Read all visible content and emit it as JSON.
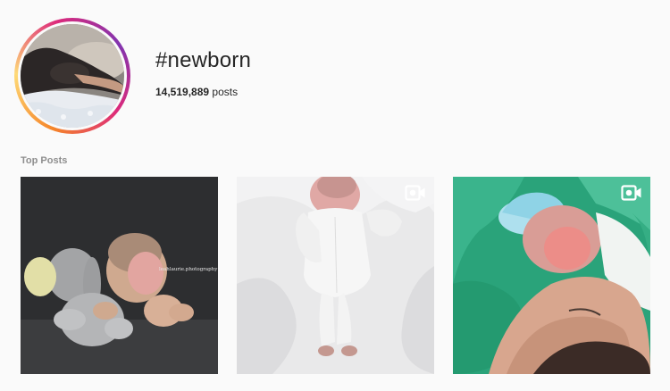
{
  "hashtag": {
    "title": "#newborn",
    "post_count": "14,519,889",
    "post_count_suffix": " posts"
  },
  "section": {
    "title": "Top Posts"
  },
  "posts": [
    {
      "watermark": "leahlaurie.photography",
      "media": "photo",
      "icon": ""
    },
    {
      "watermark": "",
      "media": "video",
      "icon": "video-camera-icon"
    },
    {
      "watermark": "",
      "media": "video",
      "icon": "video-camera-icon"
    }
  ],
  "colors": {
    "background": "#fafafa",
    "text": "#262626",
    "muted": "#8e8e8e",
    "ring_gradient": [
      "#f58529",
      "#feda77",
      "#dd2a7b",
      "#8134af"
    ]
  }
}
